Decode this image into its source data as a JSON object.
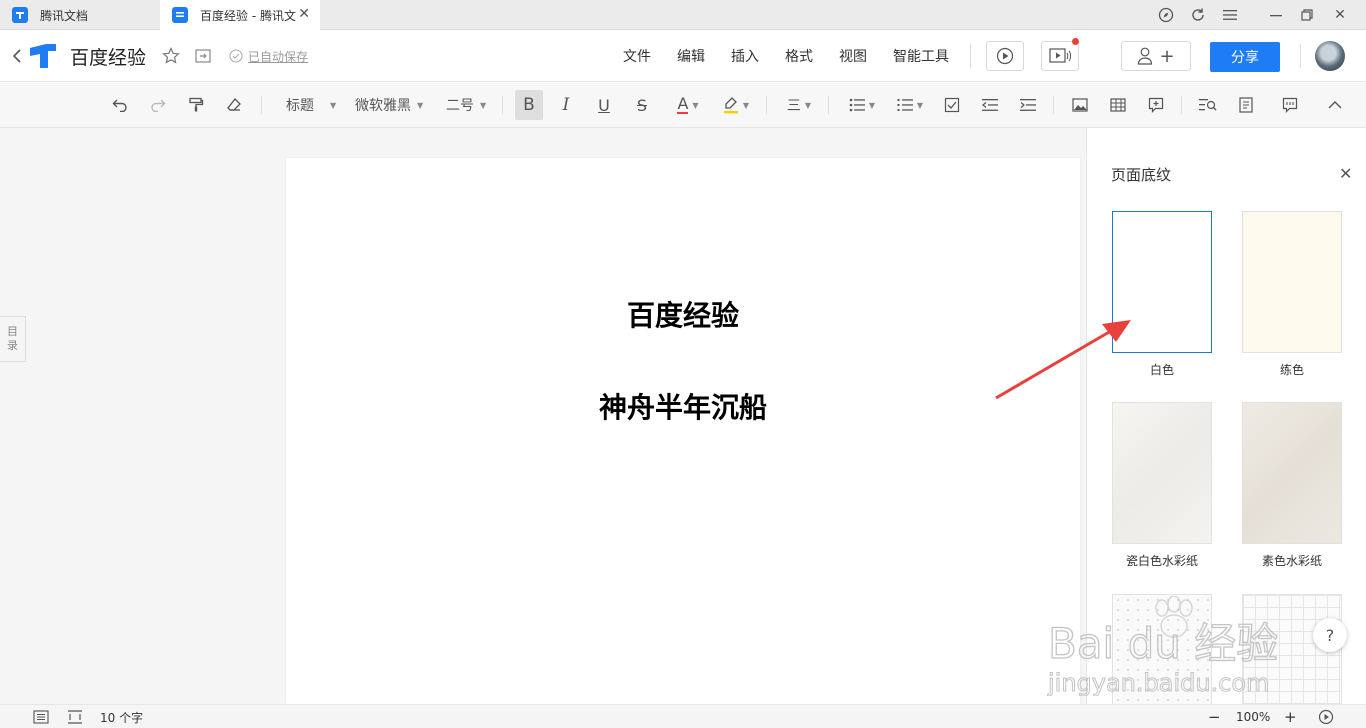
{
  "titlebar": {
    "tabs": [
      {
        "label": "腾讯文档"
      },
      {
        "label": "百度经验 - 腾讯文"
      }
    ]
  },
  "header": {
    "doc_title": "百度经验",
    "autosave": "已自动保存",
    "menu": [
      "文件",
      "编辑",
      "插入",
      "格式",
      "视图",
      "智能工具"
    ],
    "share_label": "分享",
    "add_collab": "+"
  },
  "toolbar": {
    "style_label": "标题",
    "font_label": "微软雅黑",
    "size_label": "二号",
    "bold": "B",
    "italic": "I",
    "underline": "U",
    "strike": "S",
    "fontcolor": "A",
    "align": "三"
  },
  "document": {
    "title": "百度经验",
    "line2": "神舟半年沉船"
  },
  "toc_tab": {
    "line1": "目",
    "line2": "录"
  },
  "panel": {
    "title": "页面底纹",
    "swatches": [
      {
        "label": "白色",
        "color": "#ffffff"
      },
      {
        "label": "练色",
        "color": "#fdf9ec"
      },
      {
        "label": "瓷白色水彩纸",
        "color": "#f3f2ef"
      },
      {
        "label": "素色水彩纸",
        "color": "#ece8e1"
      }
    ]
  },
  "statusbar": {
    "wordcount": "10 个字",
    "zoom": "100%",
    "minus": "−",
    "plus": "+"
  },
  "help": "?",
  "watermark": {
    "logo": "Bai du 经验",
    "url": "jingyan.baidu.com"
  },
  "colors": {
    "accent": "#1e7cf5",
    "selection_border": "#1a7ad3",
    "arrow": "#e8403a"
  }
}
